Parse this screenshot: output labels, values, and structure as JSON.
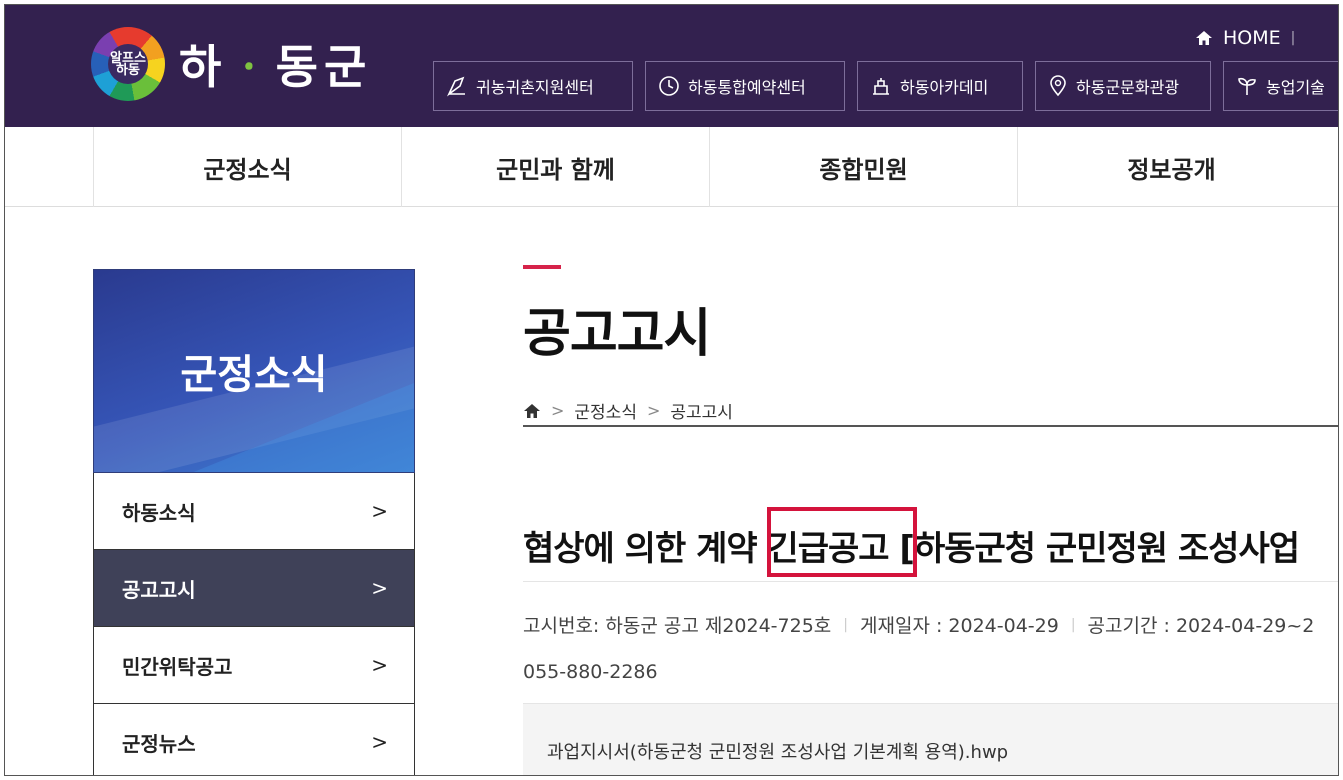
{
  "header": {
    "logo_text": "하동군",
    "emblem_text": "알프스\n하동",
    "home_label": "HOME",
    "quick_links": [
      {
        "label": "귀농귀촌지원센터",
        "icon": "pen-icon"
      },
      {
        "label": "하동통합예약센터",
        "icon": "clock-icon"
      },
      {
        "label": "하동아카데미",
        "icon": "building-icon"
      },
      {
        "label": "하동군문화관광",
        "icon": "map-pin-icon"
      },
      {
        "label": "농업기술",
        "icon": "sprout-icon"
      }
    ]
  },
  "gnb": [
    "군정소식",
    "군민과 함께",
    "종합민원",
    "정보공개"
  ],
  "sidebar": {
    "title": "군정소식",
    "items": [
      {
        "label": "하동소식",
        "active": false
      },
      {
        "label": "공고고시",
        "active": true
      },
      {
        "label": "민간위탁공고",
        "active": false
      },
      {
        "label": "군정뉴스",
        "active": false
      }
    ]
  },
  "main": {
    "page_title": "공고고시",
    "breadcrumb": [
      "군정소식",
      "공고고시"
    ],
    "post_title": "협상에 의한 계약 긴급공고 [하동군청 군민정원 조성사업",
    "highlighted_word": "긴급공고",
    "meta": [
      "고시번호: 하동군 공고 제2024-725호",
      "게재일자 : 2024-04-29",
      "공고기간 : 2024-04-29~2"
    ],
    "phone": "055-880-2286",
    "attachment": "과업지시서(하동군청 군민정원 조성사업 기본계획 용역).hwp"
  },
  "colors": {
    "topbar": "#33214f",
    "sidebar_active": "#3f4158",
    "accent": "#d6234a",
    "highlight_box": "#d4133c"
  }
}
